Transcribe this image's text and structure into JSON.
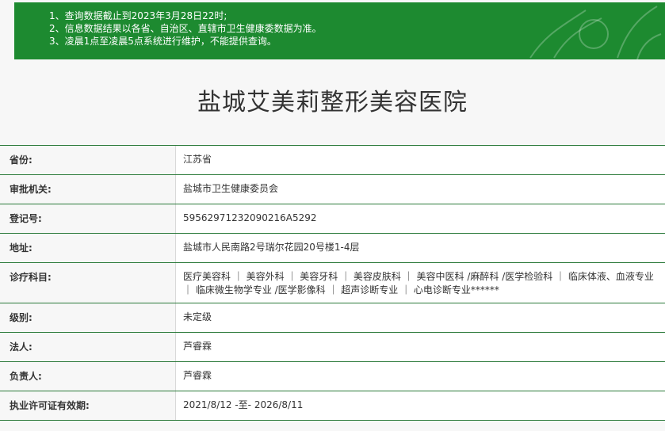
{
  "notice": {
    "lines": [
      "1、查询数据截止到2023年3月28日22时;",
      "2、信息数据结果以各省、自治区、直辖市卫生健康委数据为准。",
      "3、凌晨1点至凌晨5点系统进行维护，不能提供查询。"
    ]
  },
  "title": "盐城艾美莉整形美容医院",
  "rows": [
    {
      "label": "省份:",
      "value": "江苏省"
    },
    {
      "label": "审批机关:",
      "value": "盐城市卫生健康委员会"
    },
    {
      "label": "登记号:",
      "value": "59562971232090216A5292"
    },
    {
      "label": "地址:",
      "value": "盐城市人民南路2号瑞尔花园20号楼1-4层"
    },
    {
      "label": "诊疗科目:",
      "value": "医疗美容科 ｜ 美容外科 ｜ 美容牙科 ｜ 美容皮肤科 ｜ 美容中医科 /麻醉科 /医学检验科 ｜ 临床体液、血液专业 ｜ 临床微生物学专业 /医学影像科 ｜ 超声诊断专业 ｜ 心电诊断专业******"
    },
    {
      "label": "级别:",
      "value": "未定级"
    },
    {
      "label": "法人:",
      "value": "芦睿霖"
    },
    {
      "label": "负责人:",
      "value": "芦睿霖"
    },
    {
      "label": "执业许可证有效期:",
      "value": "2021/8/12 -至- 2026/8/11"
    }
  ],
  "colors": {
    "notice_bg": "#1d8a30",
    "border": "#2b7a3a"
  },
  "icons": [
    "leaf-decoration-icon"
  ]
}
